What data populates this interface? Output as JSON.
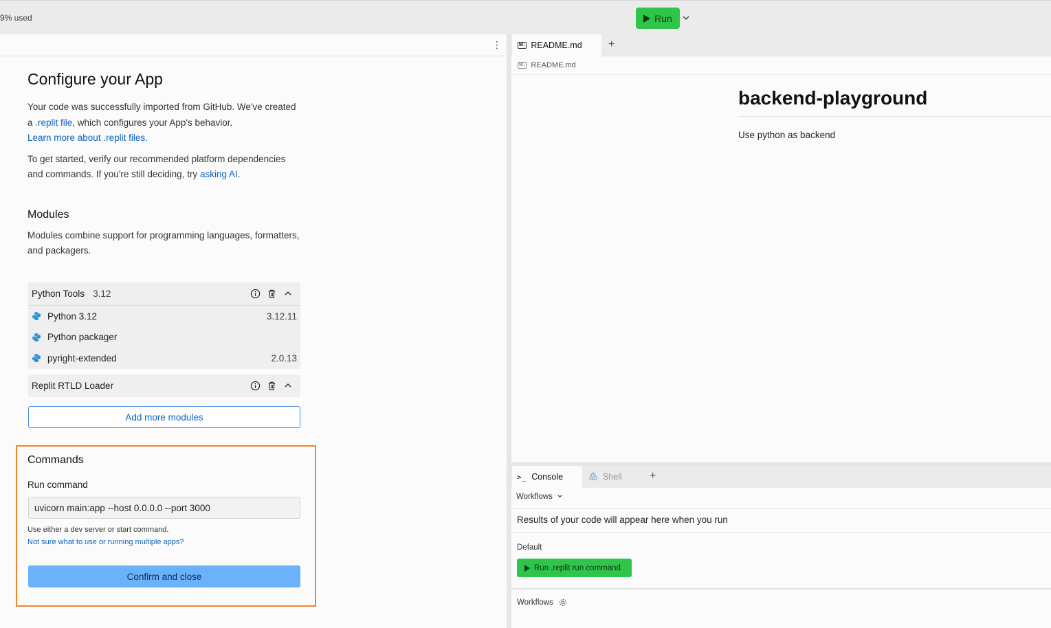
{
  "topbar": {
    "usage_text": "9% used",
    "run_label": "Run",
    "run_caret": "⌄"
  },
  "left": {
    "menu_icon": "⋮",
    "title": "Configure your App",
    "intro": {
      "p1_a": "Your code was successfully imported from GitHub. We've created a ",
      "p1_link": ".replit file",
      "p1_b": ", which configures your App's behavior.",
      "p1_learn": "Learn more about .replit files.",
      "p2_a": "To get started, verify our recommended platform dependencies and commands. If you're still deciding, try ",
      "p2_link": "asking AI",
      "p2_b": "."
    },
    "modules": {
      "heading": "Modules",
      "description": "Modules combine support for programming languages, formatters, and packagers.",
      "groups": [
        {
          "name": "Python Tools",
          "version": "3.12",
          "items": [
            {
              "name": "Python 3.12",
              "version": "3.12.11"
            },
            {
              "name": "Python packager",
              "version": ""
            },
            {
              "name": "pyright-extended",
              "version": "2.0.13"
            }
          ]
        },
        {
          "name": "Replit RTLD Loader",
          "version": "",
          "items": []
        }
      ],
      "add_button": "Add more modules"
    },
    "commands": {
      "heading": "Commands",
      "run_label": "Run command",
      "run_value": "uvicorn main:app --host 0.0.0.0 --port 3000",
      "hint": "Use either a dev server or start command.",
      "help_link": "Not sure what to use or running multiple apps?",
      "confirm": "Confirm and close"
    }
  },
  "editor": {
    "tab_label": "README.md",
    "badge": "M↓",
    "plus": "+",
    "breadcrumb": "README.md",
    "heading": "backend-playground",
    "body": "Use python as backend"
  },
  "console": {
    "tabs": [
      {
        "label": "Console",
        "icon": ">_"
      },
      {
        "label": "Shell",
        "icon": "shell-icon"
      }
    ],
    "plus": "+",
    "workflows_dropdown": "Workflows",
    "results_text": "Results of your code will appear here when you run",
    "default_label": "Default",
    "run_button": "Run .replit run command",
    "workflows_label": "Workflows"
  },
  "colors": {
    "run_green": "#2fc44a",
    "confirm_blue": "#6ab2fb",
    "highlight_orange": "#f0862c",
    "link_blue": "#0b63c4"
  }
}
